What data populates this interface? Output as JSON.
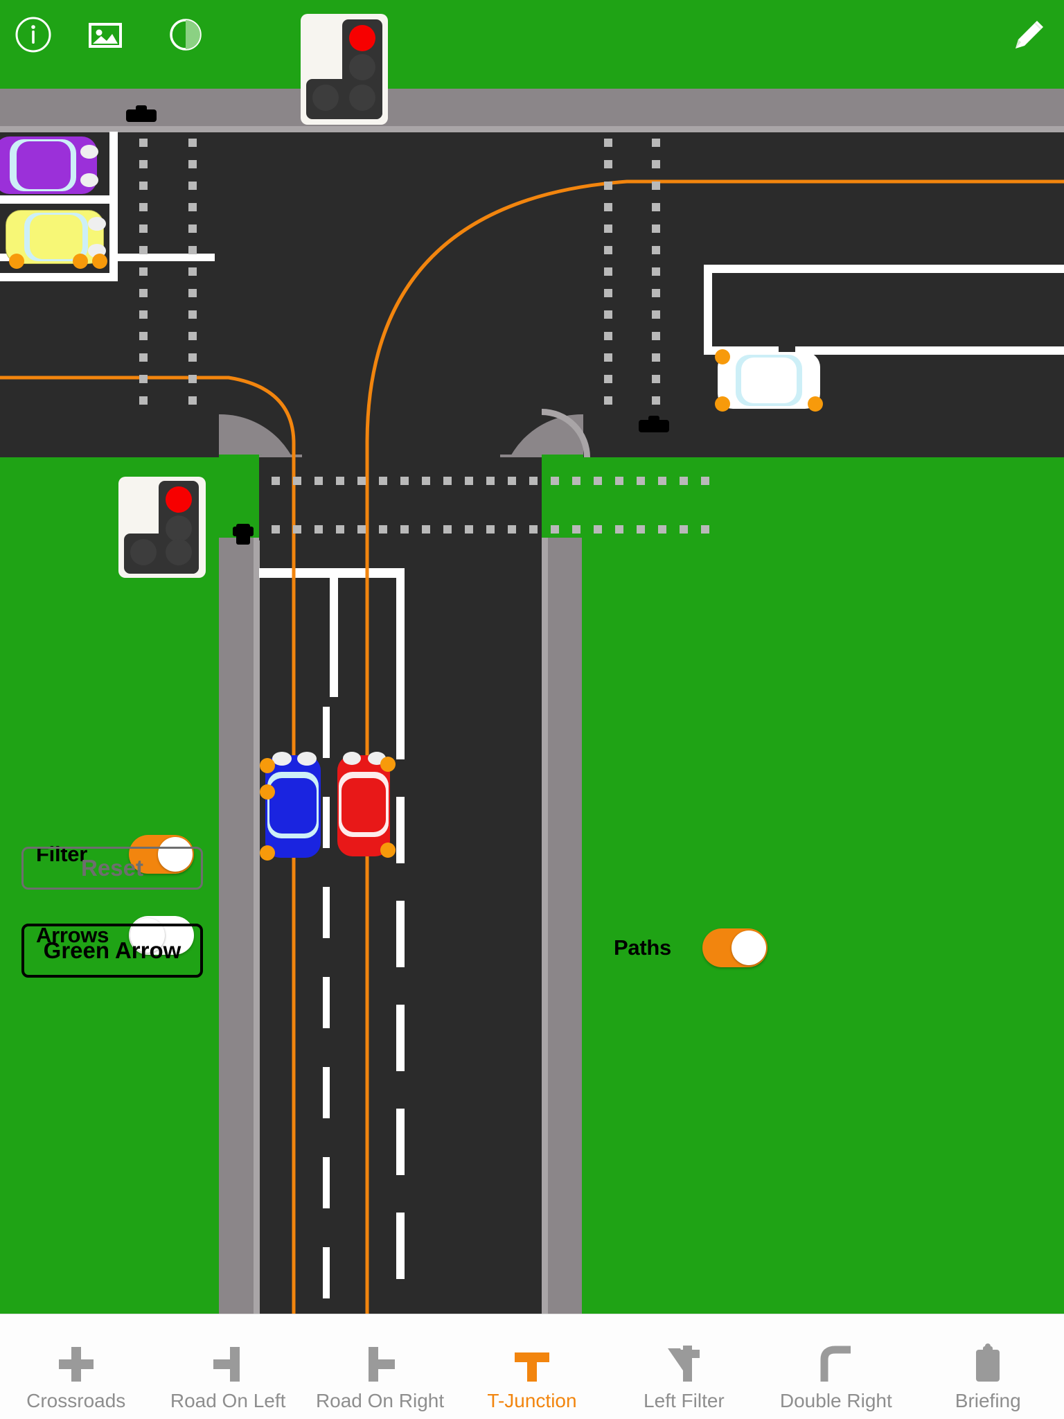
{
  "app": {
    "accent_color": "#f2850e",
    "grass_color": "#1fa315",
    "road_color": "#2b2b2b",
    "pavement_color": "#8b8689"
  },
  "toolbar": {
    "items": [
      {
        "name": "info-icon",
        "label": "Info"
      },
      {
        "name": "image-icon",
        "label": "Image"
      },
      {
        "name": "contrast-icon",
        "label": "Contrast"
      },
      {
        "name": "edit-pencil-icon",
        "label": "Edit"
      }
    ]
  },
  "controls": {
    "filter": {
      "label": "Filter",
      "state": "on"
    },
    "arrows": {
      "label": "Arrows",
      "state": "off"
    },
    "paths": {
      "label": "Paths",
      "state": "on"
    },
    "reset_button": {
      "label": "Reset",
      "enabled": false
    },
    "green_arrow_button": {
      "label": "Green Arrow",
      "enabled": true
    }
  },
  "scene": {
    "junction_type": "T-Junction",
    "traffic_lights": [
      {
        "name": "traffic-light-north",
        "aspect": "red",
        "filter_arm": "left"
      },
      {
        "name": "traffic-light-south",
        "aspect": "red",
        "filter_arm": "left"
      }
    ],
    "vehicles": [
      {
        "name": "car-purple",
        "color": "#9b30d9",
        "heading": "east"
      },
      {
        "name": "car-yellow",
        "color": "#f7f776",
        "heading": "east"
      },
      {
        "name": "car-white",
        "color": "#ffffff",
        "heading": "west"
      },
      {
        "name": "car-blue",
        "color": "#1a24e0",
        "heading": "north"
      },
      {
        "name": "car-red",
        "color": "#e81818",
        "heading": "north"
      }
    ]
  },
  "tabs": [
    {
      "label": "Crossroads",
      "icon": "crossroads-icon",
      "active": false
    },
    {
      "label": "Road On Left",
      "icon": "road-on-left-icon",
      "active": false
    },
    {
      "label": "Road On Right",
      "icon": "road-on-right-icon",
      "active": false
    },
    {
      "label": "T-Junction",
      "icon": "t-junction-icon",
      "active": true
    },
    {
      "label": "Left Filter",
      "icon": "left-filter-icon",
      "active": false
    },
    {
      "label": "Double Right",
      "icon": "double-right-icon",
      "active": false
    },
    {
      "label": "Briefing",
      "icon": "briefing-icon",
      "active": false
    }
  ]
}
